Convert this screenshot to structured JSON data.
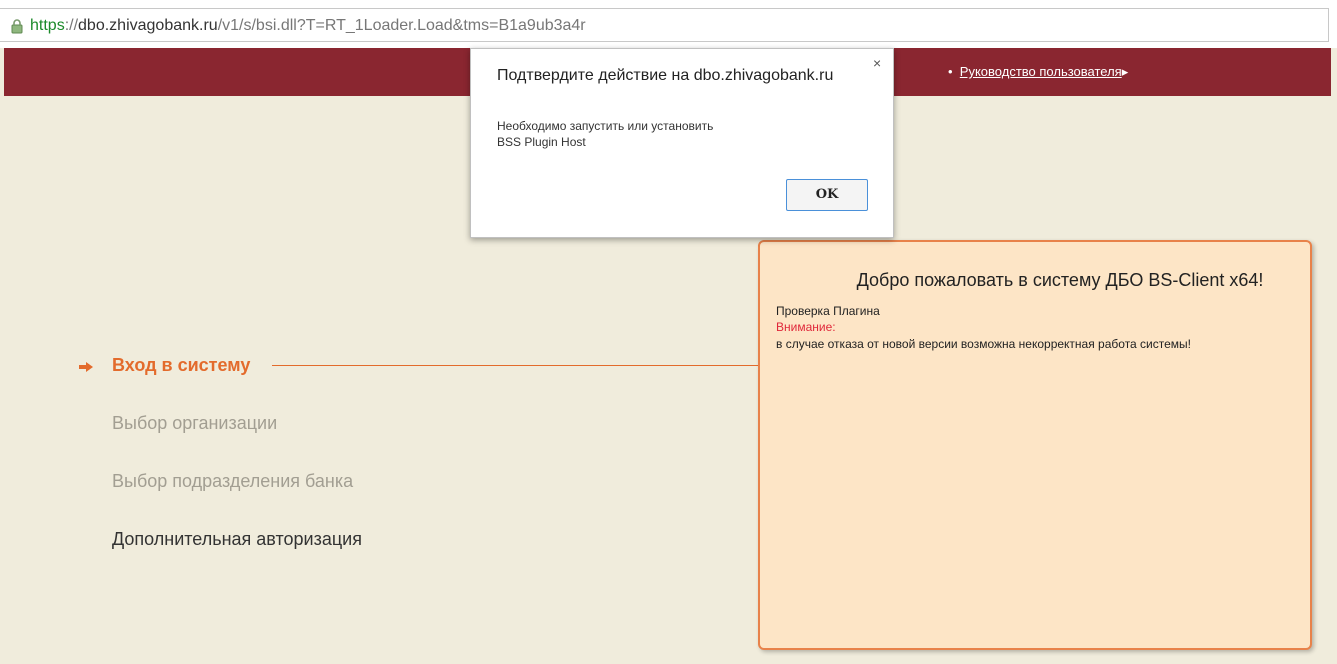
{
  "browser": {
    "url_scheme": "https",
    "url_sep": "://",
    "url_host": "dbo.zhivagobank.ru",
    "url_path": "/v1/s/bsi.dll",
    "url_query": "?T=RT_1Loader.Load&tms=B1a9ub3a4r",
    "lock_icon": "padlock-icon"
  },
  "header": {
    "bullet": "•",
    "manual_link": "Руководство пользователя",
    "arrow": "▸",
    "bg_color": "#8a2630"
  },
  "steps": [
    {
      "label": "Вход в систему",
      "state": "active"
    },
    {
      "label": "Выбор организации",
      "state": "inactive"
    },
    {
      "label": "Выбор подразделения банка",
      "state": "inactive"
    },
    {
      "label": "Дополнительная авторизация",
      "state": "pending"
    }
  ],
  "panel": {
    "title": "Добро пожаловать в систему ДБО BS-Client x64!",
    "check_label": "Проверка Плагина",
    "warning_label": "Внимание:",
    "warning_text": "в случае отказа от новой версии возможна некорректная работа системы!",
    "accent_color": "#e8824a"
  },
  "dialog": {
    "title": "Подтвердите действие на dbo.zhivagobank.ru",
    "close": "×",
    "message_line1": "Необходимо запустить или установить",
    "message_line2": "BSS Plugin Host",
    "ok_label": "OK"
  }
}
